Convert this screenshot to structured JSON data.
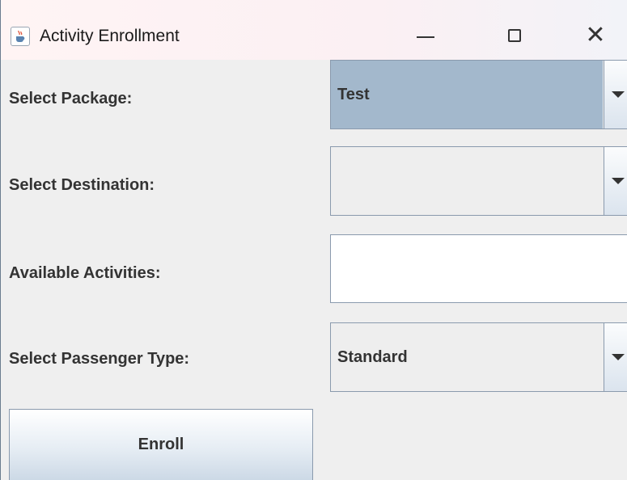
{
  "window": {
    "title": "Activity Enrollment",
    "icon": "java-cup-icon",
    "controls": [
      "minimize-icon",
      "maximize-icon",
      "close-icon"
    ],
    "close_glyph": "✕"
  },
  "form": {
    "package_label": "Select Package:",
    "package_value": "Test",
    "destination_label": "Select Destination:",
    "destination_value": "",
    "activities_label": "Available Activities:",
    "activities_value": "",
    "passenger_label": "Select Passenger Type:",
    "passenger_value": "Standard"
  },
  "actions": {
    "enroll_label": "Enroll"
  },
  "colors": {
    "selected_combo_bg": "#a3b8cc",
    "window_bg": "#efefef",
    "label_text": "#333333"
  }
}
